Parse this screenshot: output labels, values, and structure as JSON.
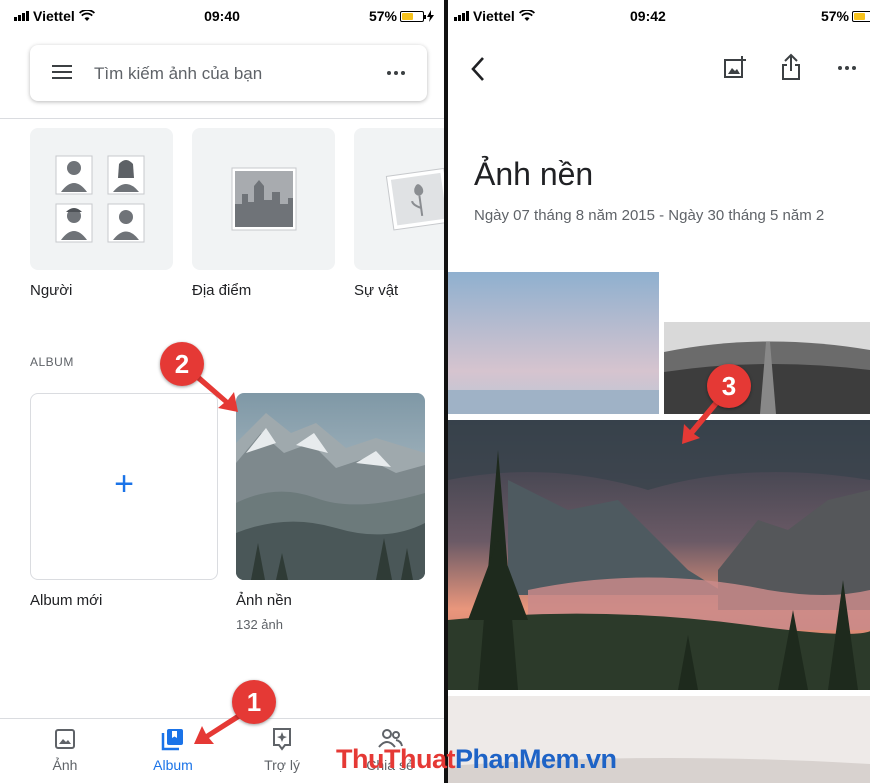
{
  "left": {
    "status": {
      "carrier": "Viettel",
      "time": "09:40",
      "battery": "57%"
    },
    "search": {
      "placeholder": "Tìm kiếm ảnh của bạn"
    },
    "categories": [
      {
        "label": "Người"
      },
      {
        "label": "Địa điểm"
      },
      {
        "label": "Sự vật"
      }
    ],
    "album_section": "ALBUM",
    "new_album": {
      "label": "Album mới",
      "icon": "+"
    },
    "album": {
      "title": "Ảnh nền",
      "count": "132 ảnh"
    },
    "nav": [
      {
        "label": "Ảnh",
        "icon": "photo-icon"
      },
      {
        "label": "Album",
        "icon": "album-icon",
        "active": true
      },
      {
        "label": "Trợ lý",
        "icon": "assistant-icon"
      },
      {
        "label": "Chia sẻ",
        "icon": "sharing-icon"
      }
    ]
  },
  "right": {
    "status": {
      "carrier": "Viettel",
      "time": "09:42",
      "battery": "57%"
    },
    "title": "Ảnh nền",
    "date_range": "Ngày 07 tháng 8 năm 2015 - Ngày 30 tháng 5 năm 2"
  },
  "badges": [
    "2",
    "1",
    "3"
  ],
  "watermark": {
    "part1": "ThuThuat",
    "part2": "PhanMem",
    "part3": ".vn"
  },
  "colors": {
    "accent": "#1a73e8",
    "badge": "#e53935",
    "battery": "#f6c21c"
  }
}
